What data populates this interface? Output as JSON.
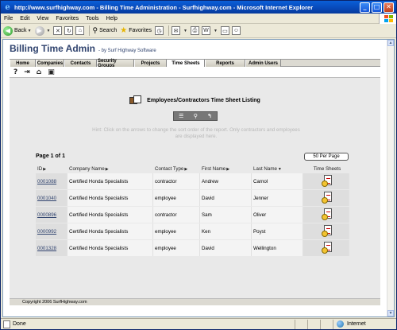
{
  "window": {
    "title": "http://www.surfhighway.com - Billing Time Administration - Surfhighway.com - Microsoft Internet Explorer",
    "minimize_glyph": "_",
    "maximize_glyph": "□",
    "close_glyph": "✕"
  },
  "menu": [
    "File",
    "Edit",
    "View",
    "Favorites",
    "Tools",
    "Help"
  ],
  "toolbar": {
    "back_label": "Back",
    "search_label": "Search",
    "favorites_label": "Favorites"
  },
  "app": {
    "title": "Billing Time Admin",
    "subtitle": "- by Surf Highway Software"
  },
  "tabs": [
    {
      "label": "Home",
      "w": 33
    },
    {
      "label": "Companies",
      "w": 36
    },
    {
      "label": "Contacts",
      "w": 41
    },
    {
      "label": "Security Groups",
      "w": 47
    },
    {
      "label": "Projects",
      "w": 41
    },
    {
      "label": "Time Sheets",
      "w": 48,
      "active": true
    },
    {
      "label": "Reports",
      "w": 51
    },
    {
      "label": "Admin Users",
      "w": 45
    }
  ],
  "listing": {
    "title": "Employees/Contractors Time Sheet Listing",
    "hint": "Hint: Click on the arrows to change the sort order of the report. Only contractors and employees are displayed here.",
    "page_info": "Page 1 of 1",
    "per_page": "50 Per Page"
  },
  "columns": {
    "id": "ID",
    "company": "Company Name",
    "contact_type": "Contact Type",
    "first_name": "First Name",
    "last_name": "Last Name",
    "time_sheets": "Time Sheets"
  },
  "rows": [
    {
      "id": "0001088",
      "company": "Certified Honda Specialists",
      "contact_type": "contractor",
      "first_name": "Andrew",
      "last_name": "Carnol"
    },
    {
      "id": "0001040",
      "company": "Certified Honda Specialists",
      "contact_type": "employee",
      "first_name": "David",
      "last_name": "Jenner"
    },
    {
      "id": "0000896",
      "company": "Certified Honda Specialists",
      "contact_type": "contractor",
      "first_name": "Sam",
      "last_name": "Oliver"
    },
    {
      "id": "0000992",
      "company": "Certified Honda Specialists",
      "contact_type": "employee",
      "first_name": "Ken",
      "last_name": "Poyst"
    },
    {
      "id": "0001328",
      "company": "Certified Honda Specialists",
      "contact_type": "employee",
      "first_name": "David",
      "last_name": "Wellington"
    }
  ],
  "footer": {
    "copyright": "Copyright  2006  SurfHighway.com"
  },
  "status": {
    "text": "Done",
    "zone": "Internet"
  }
}
